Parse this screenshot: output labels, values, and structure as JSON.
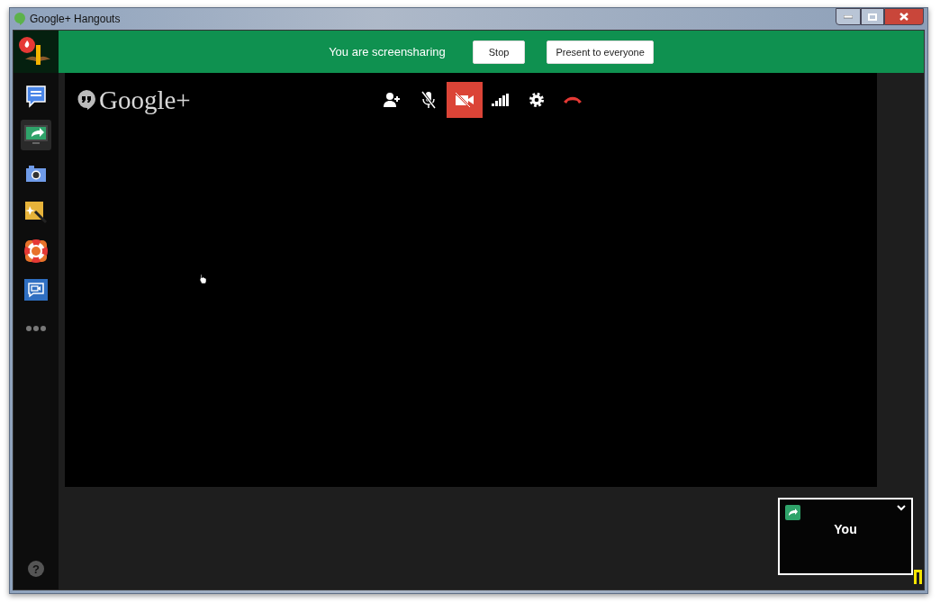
{
  "window": {
    "title": "Google+ Hangouts"
  },
  "banner": {
    "message": "You are screensharing",
    "buttons": [
      "Stop",
      "Present to everyone"
    ]
  },
  "sidebar": {
    "items": [
      {
        "kind": "chat",
        "selected": false
      },
      {
        "kind": "screenshare",
        "selected": true
      },
      {
        "kind": "capture",
        "selected": false
      },
      {
        "kind": "effects",
        "selected": false
      },
      {
        "kind": "help",
        "selected": false
      },
      {
        "kind": "remote",
        "selected": false
      },
      {
        "kind": "more",
        "selected": false
      }
    ],
    "help": "?"
  },
  "logo": {
    "text": "Google+"
  },
  "toolbar": [
    {
      "kind": "invite",
      "active": false
    },
    {
      "kind": "mic",
      "active": false
    },
    {
      "kind": "camera",
      "active": true
    },
    {
      "kind": "signal",
      "active": false
    },
    {
      "kind": "settings",
      "active": false
    },
    {
      "kind": "hangup",
      "active": false
    }
  ],
  "self_view": {
    "name": "You"
  }
}
